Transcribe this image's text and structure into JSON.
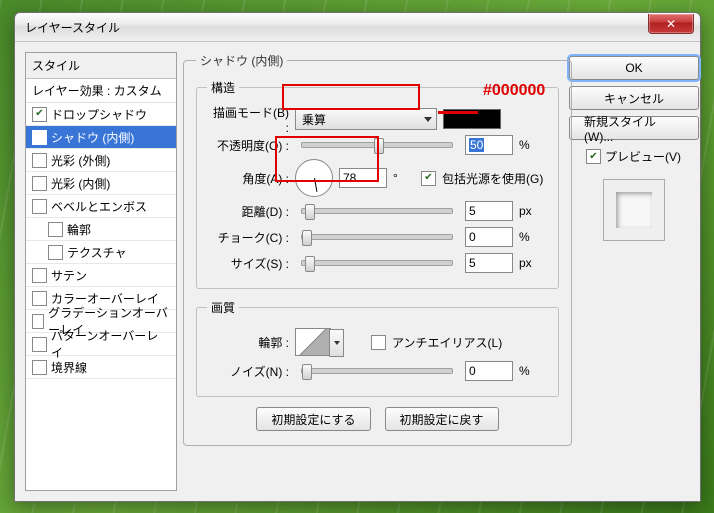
{
  "window": {
    "title": "レイヤースタイル"
  },
  "annotations": {
    "color_hex": "#000000"
  },
  "styles": {
    "header": "スタイル",
    "subhead": "レイヤー効果 : カスタム",
    "items": [
      {
        "label": "ドロップシャドウ",
        "checked": true,
        "selected": false,
        "indent": false
      },
      {
        "label": "シャドウ (内側)",
        "checked": true,
        "selected": true,
        "indent": false
      },
      {
        "label": "光彩 (外側)",
        "checked": false,
        "selected": false,
        "indent": false
      },
      {
        "label": "光彩 (内側)",
        "checked": false,
        "selected": false,
        "indent": false
      },
      {
        "label": "ベベルとエンボス",
        "checked": false,
        "selected": false,
        "indent": false
      },
      {
        "label": "輪郭",
        "checked": false,
        "selected": false,
        "indent": true
      },
      {
        "label": "テクスチャ",
        "checked": false,
        "selected": false,
        "indent": true
      },
      {
        "label": "サテン",
        "checked": false,
        "selected": false,
        "indent": false
      },
      {
        "label": "カラーオーバーレイ",
        "checked": false,
        "selected": false,
        "indent": false
      },
      {
        "label": "グラデーションオーバーレイ",
        "checked": false,
        "selected": false,
        "indent": false
      },
      {
        "label": "パターンオーバーレイ",
        "checked": false,
        "selected": false,
        "indent": false
      },
      {
        "label": "境界線",
        "checked": false,
        "selected": false,
        "indent": false
      }
    ]
  },
  "panel": {
    "title": "シャドウ (内側)",
    "structure": {
      "legend": "構造",
      "blend_mode_label": "描画モード(B) :",
      "blend_mode_value": "乗算",
      "color": "#000000",
      "opacity_label": "不透明度(O) :",
      "opacity_value": "50",
      "opacity_unit": "%",
      "angle_label": "角度(A) :",
      "angle_value": "78",
      "angle_unit": "°",
      "global_light_label": "包括光源を使用(G)",
      "global_light_checked": true,
      "distance_label": "距離(D) :",
      "distance_value": "5",
      "distance_unit": "px",
      "choke_label": "チョーク(C) :",
      "choke_value": "0",
      "choke_unit": "%",
      "size_label": "サイズ(S) :",
      "size_value": "5",
      "size_unit": "px"
    },
    "quality": {
      "legend": "画質",
      "contour_label": "輪郭 :",
      "antialias_label": "アンチエイリアス(L)",
      "antialias_checked": false,
      "noise_label": "ノイズ(N) :",
      "noise_value": "0",
      "noise_unit": "%"
    },
    "buttons": {
      "make_default": "初期設定にする",
      "reset_default": "初期設定に戻す"
    }
  },
  "right": {
    "ok": "OK",
    "cancel": "キャンセル",
    "new_style": "新規スタイル(W)...",
    "preview_label": "プレビュー(V)",
    "preview_checked": true
  }
}
